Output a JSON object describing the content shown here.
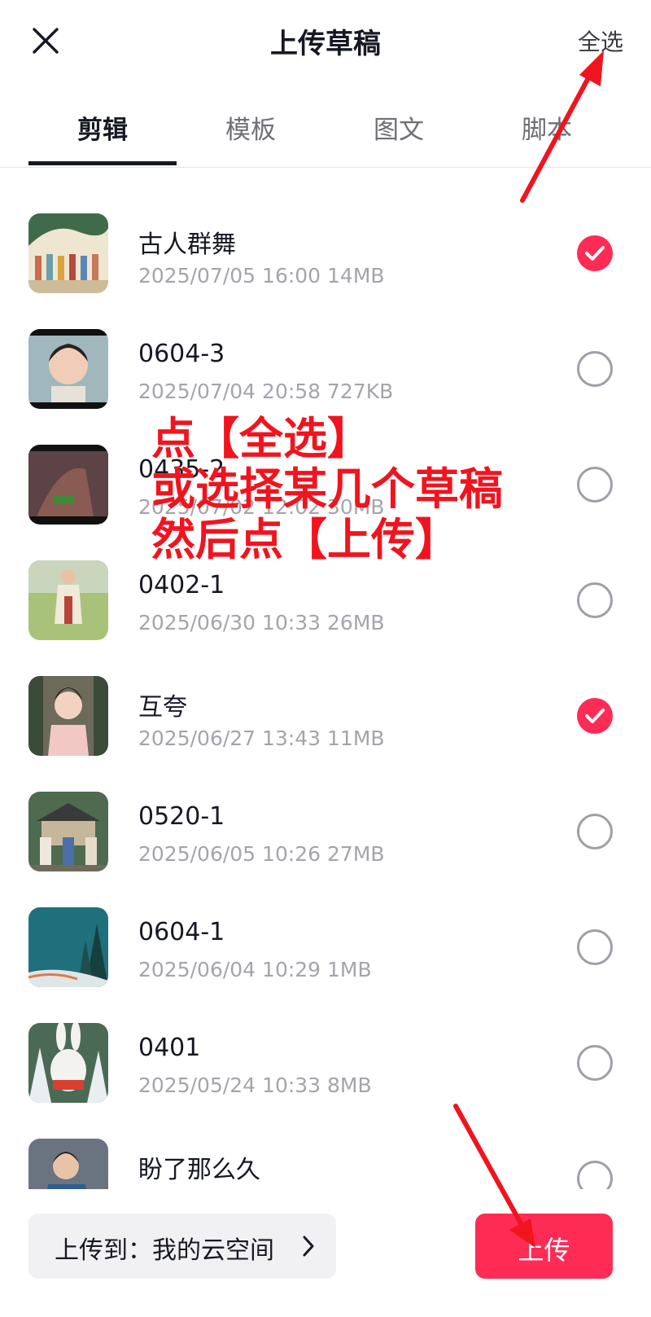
{
  "header": {
    "title": "上传草稿",
    "select_all_label": "全选",
    "close_icon": "close-icon"
  },
  "tabs": [
    {
      "label": "剪辑",
      "active": true
    },
    {
      "label": "模板",
      "active": false
    },
    {
      "label": "图文",
      "active": false
    },
    {
      "label": "脚本",
      "active": false
    }
  ],
  "drafts": [
    {
      "title": "古人群舞",
      "meta": "2025/07/05 16:00 14MB",
      "selected": true
    },
    {
      "title": "0604-3",
      "meta": "2025/07/04 20:58 727KB",
      "selected": false
    },
    {
      "title": "0435-2",
      "meta": "2025/07/02 12:02 30MB",
      "selected": false
    },
    {
      "title": "0402-1",
      "meta": "2025/06/30 10:33 26MB",
      "selected": false
    },
    {
      "title": "互夸",
      "meta": "2025/06/27 13:43 11MB",
      "selected": true
    },
    {
      "title": "0520-1",
      "meta": "2025/06/05 10:26 27MB",
      "selected": false
    },
    {
      "title": "0604-1",
      "meta": "2025/06/04 10:29 1MB",
      "selected": false
    },
    {
      "title": "0401",
      "meta": "2025/05/24 10:33 8MB",
      "selected": false
    },
    {
      "title": "盼了那么久",
      "meta": "",
      "selected": false
    }
  ],
  "footer": {
    "destination_label": "上传到：我的云空间",
    "upload_label": "上传"
  },
  "annotation": {
    "lines": [
      "点【全选】",
      "或选择某几个草稿",
      "然后点【上传】"
    ],
    "color": "#f0141e"
  },
  "colors": {
    "accent": "#fe2c55",
    "text_primary": "#161823",
    "text_secondary": "#a4a5ab"
  }
}
